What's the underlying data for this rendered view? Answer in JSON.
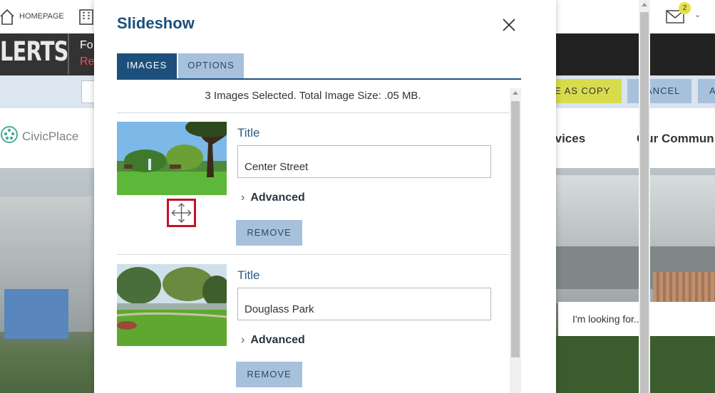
{
  "background": {
    "topbar": {
      "home_label": "HOMEPAGE",
      "mail_count": "2"
    },
    "alerts": {
      "label": "LERTS",
      "line1": "Fo",
      "line2": "Re"
    },
    "editbar": {
      "save_copy_label": "E AS COPY",
      "cancel_label": "CANCEL",
      "extra_label": "A"
    },
    "site": {
      "logo_text": "CivicPlace",
      "nav_services": "rvices",
      "nav_community": "Our Commun"
    },
    "search_placeholder": "I'm looking for..."
  },
  "modal": {
    "title": "Slideshow",
    "tabs": [
      {
        "label": "IMAGES",
        "active": true
      },
      {
        "label": "OPTIONS",
        "active": false
      }
    ],
    "summary": "3 Images Selected. Total Image Size: .05 MB.",
    "images": [
      {
        "title_label": "Title",
        "title_value": "Center Street",
        "advanced_label": "Advanced",
        "remove_label": "REMOVE"
      },
      {
        "title_label": "Title",
        "title_value": "Douglass Park",
        "advanced_label": "Advanced",
        "remove_label": "REMOVE"
      }
    ]
  },
  "colors": {
    "primary": "#1d4f7c",
    "button_light": "#a7c0dc",
    "accent_yellow": "#d8dc4c",
    "drag_highlight": "#c0132b"
  }
}
